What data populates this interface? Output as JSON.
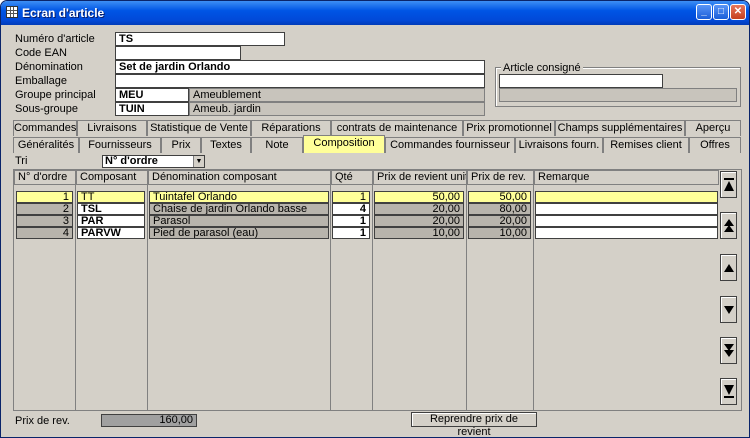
{
  "window": {
    "title": "Ecran d'article"
  },
  "form": {
    "numero_label": "Numéro d'article",
    "numero_value": "TS",
    "ean_label": "Code EAN",
    "ean_value": "",
    "denomination_label": "Dénomination",
    "denomination_value": "Set de jardin Orlando",
    "emballage_label": "Emballage",
    "emballage_value": "",
    "groupe_label": "Groupe principal",
    "groupe_code": "MEU",
    "groupe_desc": "Ameublement",
    "sousgroupe_label": "Sous-groupe",
    "sousgroupe_code": "TUIN",
    "sousgroupe_desc": "Ameub. jardin",
    "consigne_label": "Article consigné",
    "consigne_value": "",
    "consigne_desc": ""
  },
  "tabs_row1": [
    "Commandes",
    "Livraisons",
    "Statistique de Vente",
    "Réparations",
    "contrats de maintenance",
    "Prix promotionnel",
    "Champs supplémentaires",
    "Aperçu"
  ],
  "tabs_row2": [
    "Généralités",
    "Fournisseurs",
    "Prix",
    "Textes",
    "Note",
    "Composition",
    "Commandes fournisseur",
    "Livraisons fourn.",
    "Remises client",
    "Offres"
  ],
  "sort": {
    "label": "Tri",
    "value": "N° d'ordre"
  },
  "table": {
    "headers": [
      "N° d'ordre",
      "Composant",
      "Dénomination composant",
      "Qté",
      "Prix de revient unité",
      "Prix de rev.",
      "Remarque"
    ],
    "rows": [
      {
        "ordre": "1",
        "composant": "TT",
        "denomination": "Tuintafel Orlando",
        "qte": "1",
        "prix_unite": "50,00",
        "prix_rev": "50,00",
        "remarque": ""
      },
      {
        "ordre": "2",
        "composant": "TSL",
        "denomination": "Chaise de jardin Orlando basse",
        "qte": "4",
        "prix_unite": "20,00",
        "prix_rev": "80,00",
        "remarque": ""
      },
      {
        "ordre": "3",
        "composant": "PAR",
        "denomination": "Parasol",
        "qte": "1",
        "prix_unite": "20,00",
        "prix_rev": "20,00",
        "remarque": ""
      },
      {
        "ordre": "4",
        "composant": "PARVW",
        "denomination": "Pied de parasol (eau)",
        "qte": "1",
        "prix_unite": "10,00",
        "prix_rev": "10,00",
        "remarque": ""
      }
    ]
  },
  "footer": {
    "total_label": "Prix de rev.",
    "total_value": "160,00",
    "recalc_button": "Reprendre prix de revient"
  },
  "colors": {
    "active_tab": "#ffff99",
    "selected_row": "#ffff99",
    "title_bar": "#0055e5",
    "window_bg": "#d4d0c8"
  },
  "icons": {
    "nav": [
      "first-icon",
      "page-up-icon",
      "up-icon",
      "down-icon",
      "page-down-icon",
      "last-icon"
    ]
  }
}
